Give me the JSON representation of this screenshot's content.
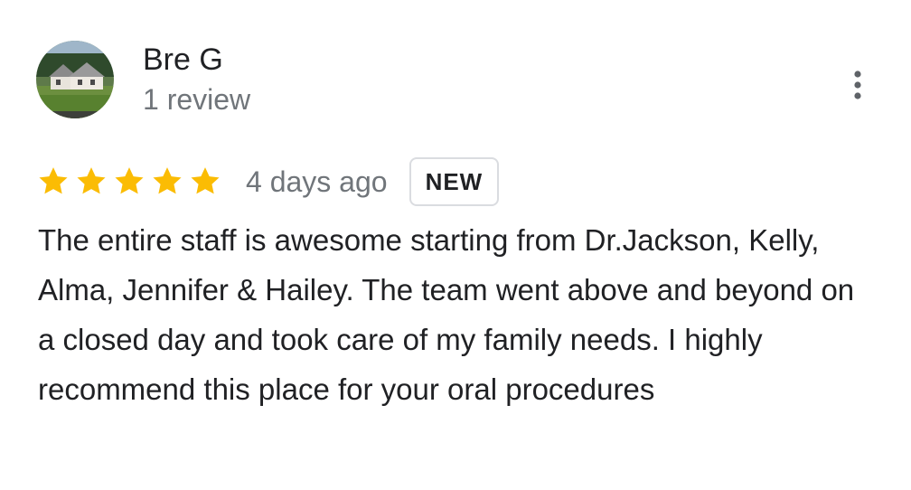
{
  "author": {
    "name": "Bre G",
    "review_count": "1 review",
    "avatar_icon": "house-photo-avatar"
  },
  "review": {
    "rating": 5,
    "rating_max": 5,
    "date": "4 days ago",
    "badge": "NEW",
    "text": "The entire staff is awesome starting from Dr.Jackson, Kelly, Alma, Jennifer & Hailey. The team went above and beyond on a closed day and took care of my family needs. I highly recommend this place for your oral procedures"
  },
  "icons": {
    "more": "more-vert-icon",
    "star": "star-icon"
  },
  "colors": {
    "star": "#fbbc04",
    "primary_text": "#202124",
    "secondary_text": "#70757a",
    "badge_border": "#dadce0"
  }
}
